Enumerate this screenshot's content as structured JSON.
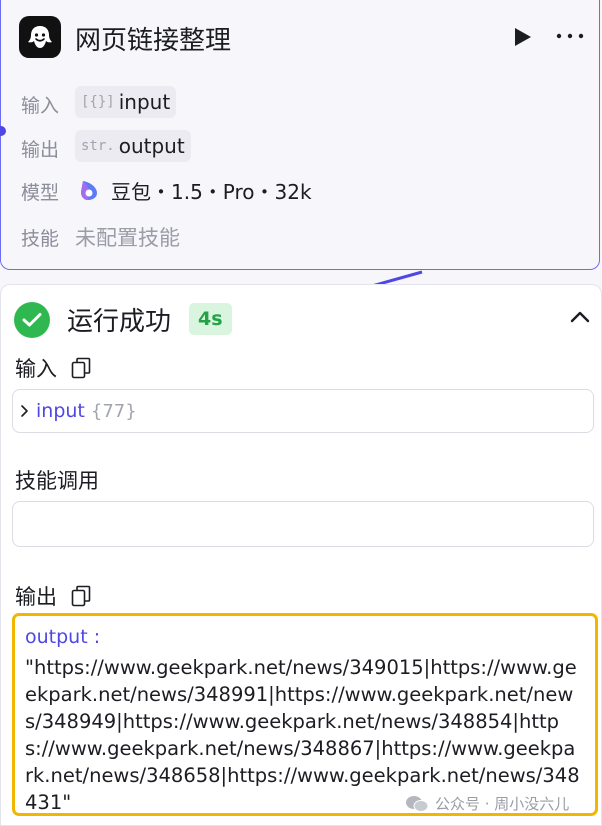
{
  "node": {
    "title": "网页链接整理",
    "input_label": "输入",
    "input_type": "[{}]",
    "input_name": "input",
    "output_label": "输出",
    "output_type": "str.",
    "output_name": "output",
    "model_label": "模型",
    "model_name": "豆包・1.5・Pro・32k",
    "skill_label": "技能",
    "skill_value": "未配置技能"
  },
  "result": {
    "status": "运行成功",
    "duration": "4s",
    "input_section": "输入",
    "input_key": "input",
    "input_count": "{77}",
    "skill_section": "技能调用",
    "output_section": "输出",
    "output_key": "output :",
    "output_value": "\"https://www.geekpark.net/news/349015|https://www.geekpark.net/news/348991|https://www.geekpark.net/news/348949|https://www.geekpark.net/news/348854|https://www.geekpark.net/news/348867|https://www.geekpark.net/news/348658|https://www.geekpark.net/news/348431\""
  },
  "watermark": "公众号 · 周小没六儿",
  "icons": {
    "node": "bot-icon",
    "run": "play-icon",
    "more": "more-icon",
    "model": "doubao-logo-icon",
    "status": "check-circle-icon",
    "collapse": "chevron-up-icon",
    "copy": "copy-icon",
    "expand": "chevron-right-icon",
    "watermark": "wechat-icon"
  },
  "colors": {
    "accent": "#4f46e5",
    "success": "#2fb84f",
    "highlight": "#f2b600"
  }
}
